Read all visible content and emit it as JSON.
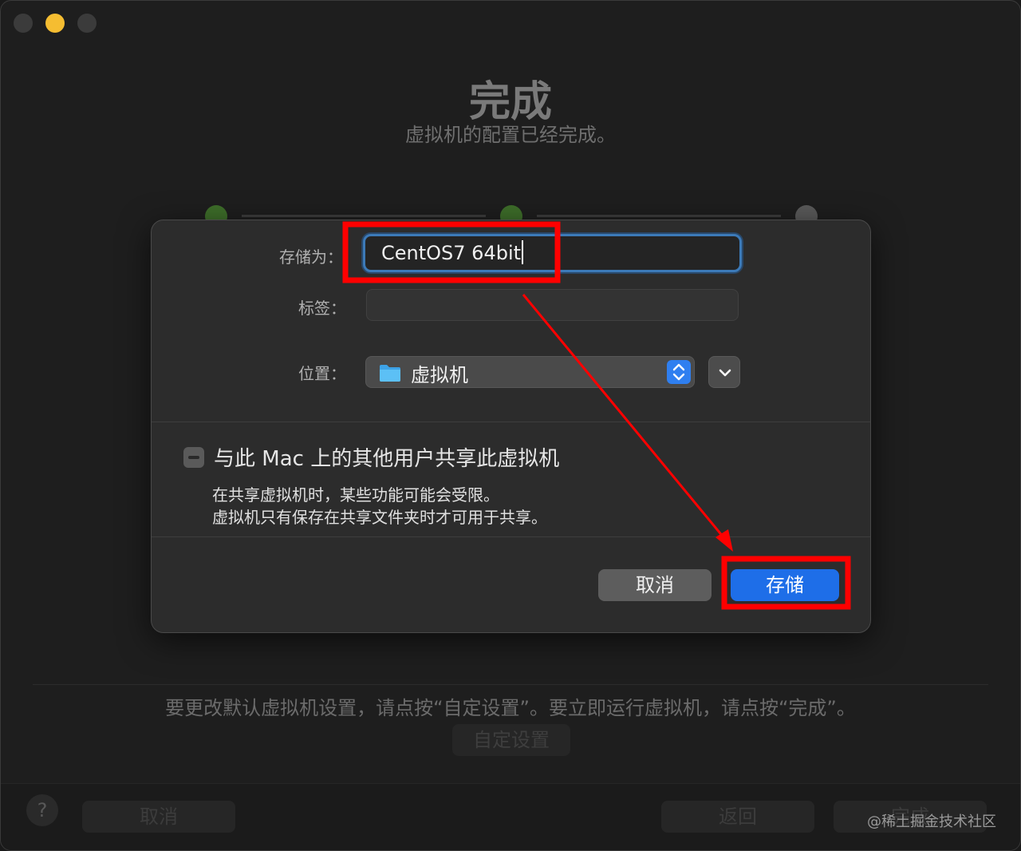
{
  "background": {
    "title": "完成",
    "subtitle": "虚拟机的配置已经完成。",
    "hint": "要更改默认虚拟机设置，请点按“自定设置”。要立即运行虚拟机，请点按“完成”。",
    "custom_button": "自定设置",
    "footer": {
      "help": "?",
      "cancel": "取消",
      "back": "返回",
      "finish": "完成"
    }
  },
  "dialog": {
    "save_as_label": "存储为：",
    "save_as_value": "CentOS7 64bit",
    "tags_label": "标签：",
    "location_label": "位置：",
    "location_value": "虚拟机",
    "share_label": "与此 Mac 上的其他用户共享此虚拟机",
    "share_note_1": "在共享虚拟机时，某些功能可能会受限。",
    "share_note_2": "虚拟机只有保存在共享文件夹时才可用于共享。",
    "cancel_label": "取消",
    "save_label": "存储"
  },
  "watermark": "@稀土掘金技术社区",
  "colors": {
    "accent": "#1e6ee8",
    "annotation": "#ff0000",
    "focus_ring": "#3c7ab8"
  }
}
